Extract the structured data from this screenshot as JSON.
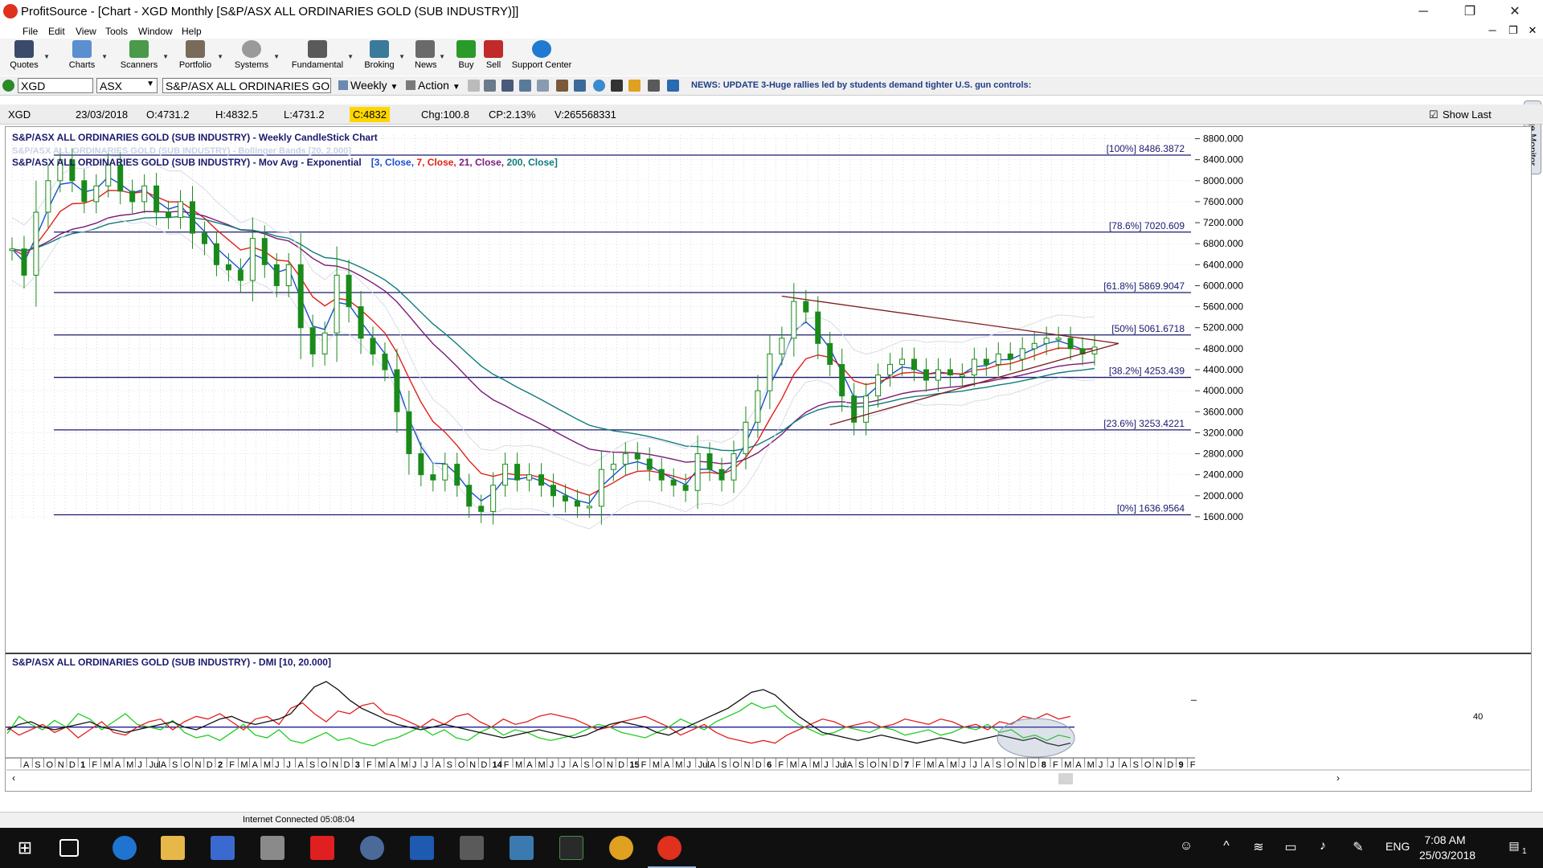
{
  "window": {
    "title": "ProfitSource - [Chart - XGD Monthly [S&P/ASX ALL ORDINARIES GOLD (SUB INDUSTRY)]]",
    "controls": [
      "─",
      "❐",
      "✕"
    ],
    "child_controls": [
      "─",
      "❐",
      "✕"
    ]
  },
  "menu": [
    "File",
    "Edit",
    "View",
    "Tools",
    "Window",
    "Help"
  ],
  "toolbar": [
    "Quotes",
    "Charts",
    "Scanners",
    "Portfolio",
    "Systems",
    "Fundamental",
    "Broking",
    "News",
    "Buy",
    "Sell",
    "Support Center"
  ],
  "symbol_bar": {
    "symbol": "XGD",
    "exchange": "ASX",
    "name": "S&P/ASX ALL ORDINARIES GOL",
    "period": "Weekly",
    "action": "Action",
    "news": "NEWS: UPDATE 3-Huge rallies led by students demand tighter U.S. gun controls:"
  },
  "quote": {
    "symbol": "XGD",
    "date": "23/03/2018",
    "open": "O:4731.2",
    "high": "H:4832.5",
    "low": "L:4731.2",
    "close": "C:4832",
    "change": "Chg:100.8",
    "change_pct": "CP:2.13%",
    "volume": "V:265568331",
    "show_last": "Show Last"
  },
  "side_tab": "Page Monitor",
  "status": "Internet Connected 05:08:04",
  "taskbar": {
    "lang": "ENG",
    "time": "7:08 AM",
    "date": "25/03/2018",
    "notif_count": "1"
  },
  "colors": {
    "chart_header": "#1a1a6e",
    "ema3": "#1a4fd0",
    "ema7": "#e0201a",
    "ema21": "#7a1a7a",
    "ema200": "#117a7a",
    "fib": "#1a1a6e",
    "candle": "#1a8a1a",
    "dmi_plus": "#22cc22",
    "dmi_minus": "#e02020",
    "adx": "#111111",
    "quote_highlight": "#ffd600"
  },
  "chart_data": {
    "type": "line",
    "title": "S&P/ASX ALL ORDINARIES GOLD (SUB INDUSTRY) - Weekly CandleStick Chart",
    "overlay_bb": "S&P/ASX ALL ORDINARIES GOLD (SUB INDUSTRY) - Bollinger Bands [20, 2.000]",
    "overlay_ma": "S&P/ASX ALL ORDINARIES GOLD (SUB INDUSTRY) - Mov Avg - Exponential",
    "ma_params": [
      {
        "text": "[3, Close, ",
        "color": "#1a4fd0"
      },
      {
        "text": "7, Close, ",
        "color": "#e0201a"
      },
      {
        "text": "21, Close, ",
        "color": "#7a1a7a"
      },
      {
        "text": "200, Close]",
        "color": "#117a7a"
      }
    ],
    "ylim": [
      1400,
      8900
    ],
    "y_ticks": [
      "8800.000",
      "8400.000",
      "8000.000",
      "7600.000",
      "7200.000",
      "6800.000",
      "6400.000",
      "6000.000",
      "5600.000",
      "5200.000",
      "4800.000",
      "4400.000",
      "4000.000",
      "3600.000",
      "3200.000",
      "2800.000",
      "2400.000",
      "2000.000",
      "1600.000"
    ],
    "fib_levels": [
      {
        "label": "[100%] 8486.3872",
        "value": 8486.3872
      },
      {
        "label": "[78.6%] 7020.609",
        "value": 7020.609
      },
      {
        "label": "[61.8%] 5869.9047",
        "value": 5869.9047
      },
      {
        "label": "[50%] 5061.6718",
        "value": 5061.6718
      },
      {
        "label": "[38.2%] 4253.439",
        "value": 4253.439
      },
      {
        "label": "[23.6%] 3253.4221",
        "value": 3253.4221
      },
      {
        "label": "[0%] 1636.9564",
        "value": 1636.9564
      }
    ],
    "price_series": {
      "name": "Close",
      "x": [
        0,
        1,
        2,
        3,
        4,
        5,
        6,
        7,
        8,
        9,
        10,
        11,
        12,
        13,
        14,
        15,
        16,
        17,
        18,
        19,
        20,
        21,
        22,
        23,
        24,
        25,
        26,
        27,
        28,
        29,
        30,
        31,
        32,
        33,
        34,
        35,
        36,
        37,
        38,
        39,
        40,
        41,
        42,
        43,
        44,
        45,
        46,
        47,
        48,
        49,
        50,
        51,
        52,
        53,
        54,
        55,
        56,
        57,
        58,
        59,
        60,
        61,
        62,
        63,
        64,
        65,
        66,
        67,
        68,
        69,
        70,
        71,
        72,
        73,
        74,
        75,
        76,
        77,
        78,
        79,
        80,
        81,
        82,
        83,
        84,
        85,
        86,
        87,
        88,
        89,
        90
      ],
      "values": [
        6700,
        6200,
        7400,
        8000,
        8400,
        8000,
        7600,
        7900,
        8300,
        7800,
        7600,
        7900,
        7400,
        7300,
        7600,
        7000,
        6800,
        6400,
        6300,
        6100,
        6900,
        6400,
        6000,
        6400,
        5200,
        4700,
        5100,
        6200,
        5600,
        5000,
        4700,
        4400,
        3600,
        2800,
        2400,
        2300,
        2600,
        2200,
        1800,
        1700,
        2200,
        2600,
        2300,
        2400,
        2200,
        2000,
        1900,
        1800,
        1800,
        2500,
        2600,
        2800,
        2700,
        2500,
        2300,
        2200,
        2100,
        2800,
        2500,
        2300,
        2800,
        3400,
        4000,
        4700,
        5000,
        5700,
        5500,
        4900,
        4500,
        3900,
        3400,
        3900,
        4300,
        4500,
        4600,
        4400,
        4200,
        4400,
        4300,
        4300,
        4600,
        4500,
        4700,
        4600,
        4800,
        4900,
        5000,
        5000,
        4800,
        4700,
        4830
      ]
    },
    "triangle": {
      "upper": [
        {
          "x": 64,
          "y": 5800
        },
        {
          "x": 92,
          "y": 4900
        }
      ],
      "lower": [
        {
          "x": 68,
          "y": 3350
        },
        {
          "x": 92,
          "y": 4900
        }
      ]
    },
    "x_ticks": [
      "A",
      "S",
      "O",
      "N",
      "D",
      "1",
      "F",
      "M",
      "A",
      "M",
      "J",
      "Jul",
      "A",
      "S",
      "O",
      "N",
      "D",
      "2",
      "F",
      "M",
      "A",
      "M",
      "J",
      "J",
      "A",
      "S",
      "O",
      "N",
      "D",
      "3",
      "F",
      "M",
      "A",
      "M",
      "J",
      "J",
      "A",
      "S",
      "O",
      "N",
      "D",
      "14",
      "F",
      "M",
      "A",
      "M",
      "J",
      "J",
      "A",
      "S",
      "O",
      "N",
      "D",
      "15",
      "F",
      "M",
      "A",
      "M",
      "J",
      "Jul",
      "A",
      "S",
      "O",
      "N",
      "D",
      "6",
      "F",
      "M",
      "A",
      "M",
      "J",
      "Jul",
      "A",
      "S",
      "O",
      "N",
      "D",
      "7",
      "F",
      "M",
      "A",
      "M",
      "J",
      "J",
      "A",
      "S",
      "O",
      "N",
      "D",
      "8",
      "F",
      "M",
      "A",
      "M",
      "J",
      "J",
      "A",
      "S",
      "O",
      "N",
      "D",
      "9",
      "F"
    ],
    "x_ticks_bold": [
      "1",
      "2",
      "3",
      "14",
      "15",
      "6",
      "7",
      "8",
      "9"
    ],
    "dmi": {
      "title": "S&P/ASX ALL ORDINARIES GOLD (SUB INDUSTRY) - DMI [10, 20.000]",
      "level": "40",
      "ylim": [
        0,
        60
      ],
      "plus_di": [
        15,
        28,
        22,
        18,
        25,
        20,
        30,
        26,
        18,
        24,
        30,
        22,
        20,
        18,
        25,
        16,
        12,
        14,
        10,
        16,
        22,
        14,
        12,
        18,
        10,
        8,
        12,
        16,
        10,
        12,
        8,
        6,
        10,
        12,
        16,
        20,
        14,
        18,
        12,
        10,
        16,
        20,
        14,
        18,
        16,
        12,
        10,
        12,
        14,
        18,
        22,
        20,
        16,
        14,
        12,
        16,
        20,
        26,
        22,
        18,
        24,
        28,
        32,
        38,
        34,
        36,
        28,
        22,
        18,
        14,
        16,
        20,
        18,
        16,
        20,
        18,
        14,
        16,
        18,
        14,
        16,
        20,
        18,
        22,
        16,
        18,
        12,
        14,
        10,
        14,
        12
      ],
      "minus_di": [
        20,
        14,
        18,
        22,
        16,
        20,
        12,
        18,
        24,
        16,
        14,
        20,
        24,
        26,
        18,
        24,
        28,
        26,
        30,
        24,
        18,
        26,
        28,
        22,
        34,
        38,
        30,
        24,
        32,
        30,
        36,
        38,
        30,
        28,
        24,
        20,
        26,
        22,
        28,
        30,
        24,
        20,
        26,
        22,
        24,
        28,
        30,
        28,
        26,
        22,
        18,
        20,
        24,
        26,
        28,
        24,
        20,
        14,
        18,
        22,
        16,
        12,
        10,
        8,
        10,
        8,
        14,
        18,
        22,
        26,
        24,
        20,
        22,
        24,
        20,
        22,
        26,
        24,
        22,
        26,
        24,
        20,
        22,
        18,
        24,
        22,
        28,
        26,
        30,
        26,
        28
      ],
      "adx": [
        18,
        22,
        24,
        20,
        18,
        20,
        22,
        24,
        20,
        18,
        16,
        18,
        20,
        22,
        24,
        20,
        18,
        22,
        26,
        28,
        24,
        22,
        24,
        26,
        30,
        40,
        50,
        54,
        48,
        40,
        34,
        30,
        26,
        22,
        20,
        18,
        20,
        22,
        20,
        18,
        16,
        14,
        12,
        14,
        16,
        18,
        16,
        14,
        12,
        14,
        18,
        22,
        24,
        22,
        20,
        16,
        14,
        18,
        22,
        26,
        30,
        34,
        40,
        46,
        48,
        44,
        36,
        28,
        22,
        16,
        14,
        12,
        10,
        12,
        14,
        12,
        10,
        8,
        10,
        12,
        10,
        8,
        10,
        12,
        14,
        12,
        10,
        12,
        8,
        6,
        8
      ]
    }
  }
}
